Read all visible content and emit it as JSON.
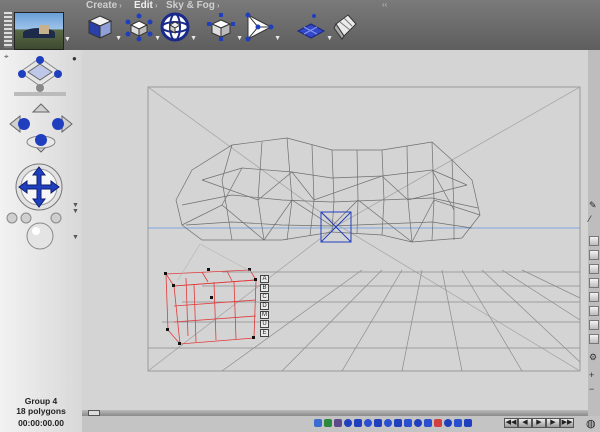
{
  "menu": {
    "create": "Create",
    "edit": "Edit",
    "sky_fog": "Sky & Fog",
    "arrow": "›"
  },
  "toolbar": {
    "tools": [
      {
        "name": "create-cube-tool",
        "icon": "cube-icon"
      },
      {
        "name": "edit-move-tool",
        "icon": "move-gizmo-icon"
      },
      {
        "name": "edit-rotate-tool",
        "icon": "rotate-gizmo-icon"
      },
      {
        "name": "edit-scale-tool",
        "icon": "scale-gizmo-icon"
      },
      {
        "name": "edit-points-tool",
        "icon": "triangle-points-icon"
      },
      {
        "name": "sky-terrain-tool",
        "icon": "grid-terrain-icon"
      },
      {
        "name": "sky-fog-tool",
        "icon": "crystal-icon"
      }
    ]
  },
  "status": {
    "object": "Group 4",
    "polygons": "18 polygons",
    "time": "00:00:00.00"
  },
  "object_tools": [
    "A",
    "B",
    "C",
    "D",
    "M",
    "U",
    "E"
  ],
  "colors": {
    "accent_blue": "#1f3fbf",
    "wire_gray": "#6f6f6f",
    "selection_red": "#e23a3a",
    "horizon_blue": "#7fa7e0"
  }
}
